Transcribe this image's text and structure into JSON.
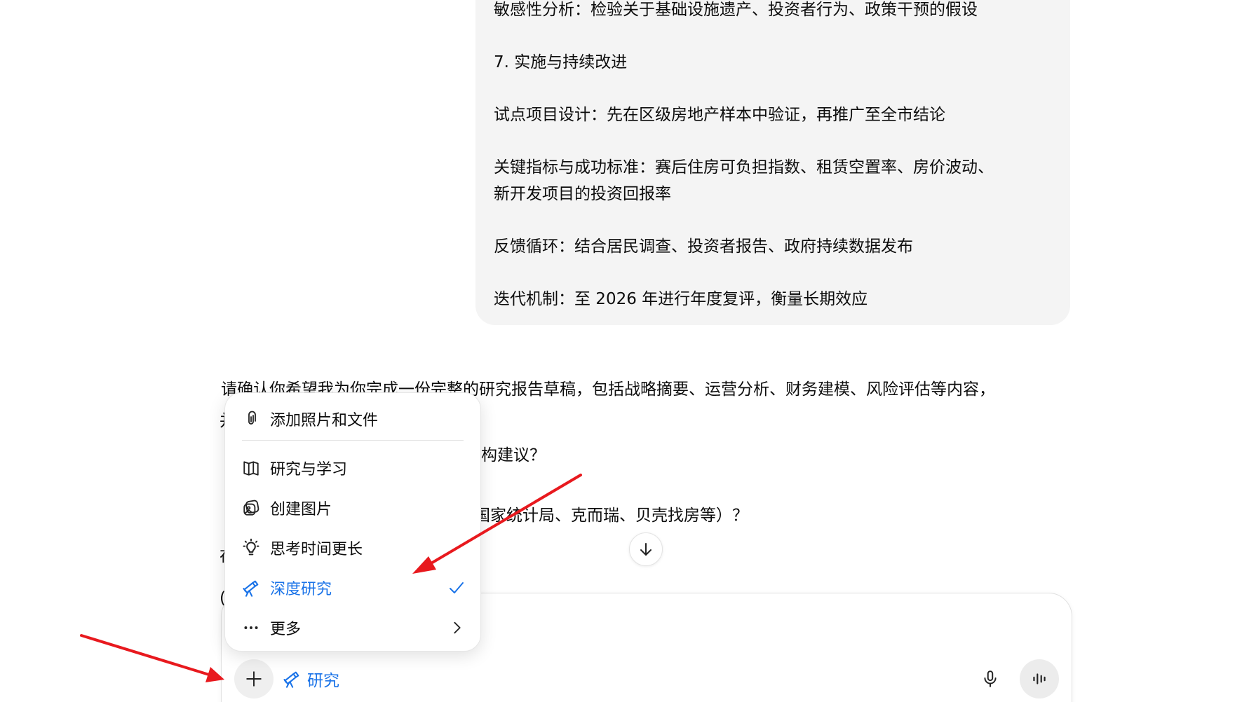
{
  "bubble": {
    "lines": [
      "敏感性分析：检验关于基础设施遗产、投资者行为、政策干预的假设",
      "7. 实施与持续改进",
      "试点项目设计：先在区级房地产样本中验证，再推广至全市结论",
      "关键指标与成功标准：赛后住房可负担指数、租赁空置率、房价波动、",
      "新开发项目的投资回报率",
      "反馈循环：结合居民调查、投资者报告、政府持续数据发布",
      "迭代机制：至 2026 年进行年度复评，衡量长期效应"
    ]
  },
  "response": {
    "line1": "请确认你希望我为你完成一份完整的研究报告草稿，包括战略摘要、运营分析、财务建模、风险评估等内容，",
    "line1_char": "并",
    "line2_tail": "构建议？",
    "line3_tail": "国家统计局、克而瑞、贝壳找房等）？",
    "line4_char": "在",
    "line5_char": "("
  },
  "menu": {
    "items": [
      {
        "label": "添加照片和文件",
        "icon": "paperclip-icon"
      },
      {
        "label": "研究与学习",
        "icon": "book-icon"
      },
      {
        "label": "创建图片",
        "icon": "image-icon"
      },
      {
        "label": "思考时间更长",
        "icon": "lightbulb-icon"
      },
      {
        "label": "深度研究",
        "icon": "telescope-icon"
      },
      {
        "label": "更多",
        "icon": "ellipsis-icon"
      }
    ]
  },
  "composer": {
    "research_label": "研究"
  },
  "colors": {
    "accent": "#1a73e8",
    "annotation": "#e8191e",
    "bubble": "#f4f4f4"
  }
}
